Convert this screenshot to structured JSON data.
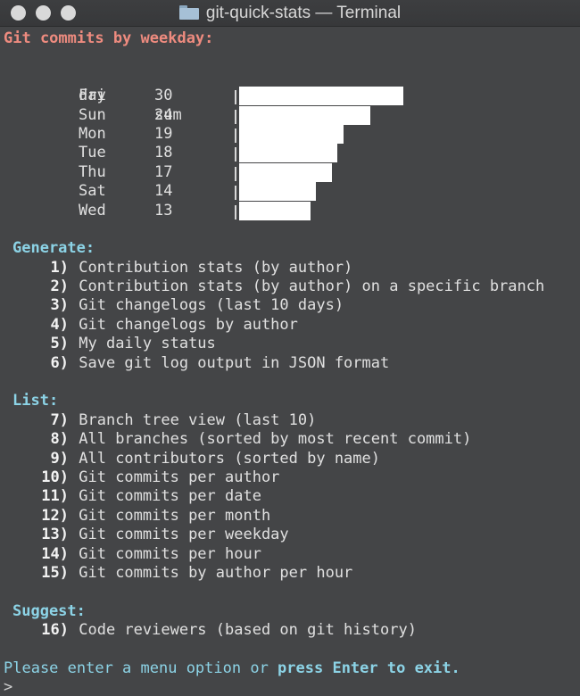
{
  "window": {
    "title": "git-quick-stats — Terminal",
    "icon": "folder-icon"
  },
  "colors": {
    "background": "#444547",
    "heading": "#ee8b7f",
    "section": "#8cd3e6",
    "text": "#e0e0e0",
    "bar": "#ffffff"
  },
  "stats": {
    "heading": "Git commits by weekday:",
    "header_day": "day",
    "header_sum": "sum",
    "max_value": 30,
    "rows": [
      {
        "day": "Fri",
        "sum": "30",
        "value": 30
      },
      {
        "day": "Sun",
        "sum": "24",
        "value": 24
      },
      {
        "day": "Mon",
        "sum": "19",
        "value": 19
      },
      {
        "day": "Tue",
        "sum": "18",
        "value": 18
      },
      {
        "day": "Thu",
        "sum": "17",
        "value": 17
      },
      {
        "day": "Sat",
        "sum": "14",
        "value": 14
      },
      {
        "day": "Wed",
        "sum": "13",
        "value": 13
      }
    ]
  },
  "menu": {
    "generate": {
      "title": "Generate:",
      "items": [
        {
          "num": "1)",
          "label": "Contribution stats (by author)"
        },
        {
          "num": "2)",
          "label": "Contribution stats (by author) on a specific branch"
        },
        {
          "num": "3)",
          "label": "Git changelogs (last 10 days)"
        },
        {
          "num": "4)",
          "label": "Git changelogs by author"
        },
        {
          "num": "5)",
          "label": "My daily status"
        },
        {
          "num": "6)",
          "label": "Save git log output in JSON format"
        }
      ]
    },
    "list": {
      "title": "List:",
      "items": [
        {
          "num": "7)",
          "label": "Branch tree view (last 10)"
        },
        {
          "num": "8)",
          "label": "All branches (sorted by most recent commit)"
        },
        {
          "num": "9)",
          "label": "All contributors (sorted by name)"
        },
        {
          "num": "10)",
          "label": "Git commits per author"
        },
        {
          "num": "11)",
          "label": "Git commits per date"
        },
        {
          "num": "12)",
          "label": "Git commits per month"
        },
        {
          "num": "13)",
          "label": "Git commits per weekday"
        },
        {
          "num": "14)",
          "label": "Git commits per hour"
        },
        {
          "num": "15)",
          "label": "Git commits by author per hour"
        }
      ]
    },
    "suggest": {
      "title": "Suggest:",
      "items": [
        {
          "num": "16)",
          "label": "Code reviewers (based on git history)"
        }
      ]
    }
  },
  "prompt": {
    "text_before": "Please enter a menu option or ",
    "text_strong": "press Enter to exit.",
    "caret": ">"
  }
}
